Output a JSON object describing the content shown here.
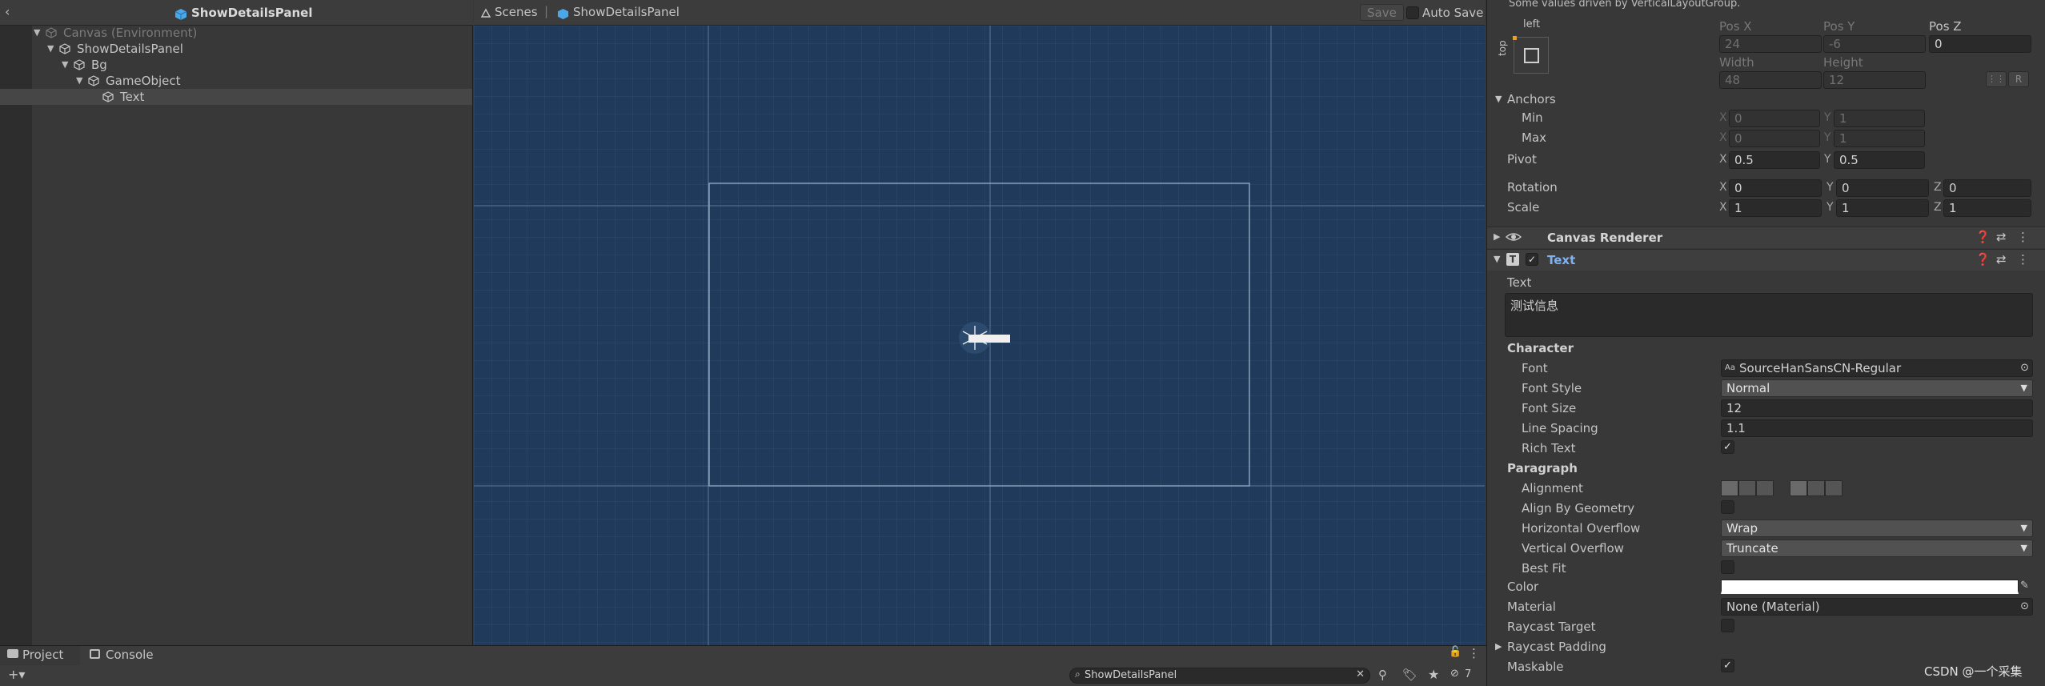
{
  "hierarchy": {
    "header_title": "ShowDetailsPanel",
    "items": [
      {
        "label": "Canvas (Environment)"
      },
      {
        "label": "ShowDetailsPanel"
      },
      {
        "label": "Bg"
      },
      {
        "label": "GameObject"
      },
      {
        "label": "Text"
      }
    ]
  },
  "scene": {
    "breadcrumb_scenes": "Scenes",
    "breadcrumb_prefab": "ShowDetailsPanel",
    "save_label": "Save",
    "autosave_label": "Auto Save"
  },
  "inspector": {
    "driven_note": "Some values driven by VerticalLayoutGroup.",
    "anchor_preset_left": "left",
    "anchor_preset_top": "top",
    "pos_labels": {
      "x": "Pos X",
      "y": "Pos Y",
      "z": "Pos Z",
      "w": "Width",
      "h": "Height"
    },
    "pos_values": {
      "x": "24",
      "y": "-6",
      "z": "0",
      "w": "48",
      "h": "12"
    },
    "raw_button": "R",
    "anchors_label": "Anchors",
    "min_label": "Min",
    "max_label": "Max",
    "anchors_min": {
      "x": "0",
      "y": "1"
    },
    "anchors_max": {
      "x": "0",
      "y": "1"
    },
    "pivot_label": "Pivot",
    "pivot": {
      "x": "0.5",
      "y": "0.5"
    },
    "rotation_label": "Rotation",
    "rotation": {
      "x": "0",
      "y": "0",
      "z": "0"
    },
    "scale_label": "Scale",
    "scale": {
      "x": "1",
      "y": "1",
      "z": "1"
    },
    "axis": {
      "x": "X",
      "y": "Y",
      "z": "Z"
    },
    "canvas_renderer_title": "Canvas Renderer",
    "text_component_title": "Text",
    "text_label": "Text",
    "text_value": "测试信息",
    "character_label": "Character",
    "font_label": "Font",
    "font_value": "SourceHanSansCN-Regular",
    "font_style_label": "Font Style",
    "font_style_value": "Normal",
    "font_size_label": "Font Size",
    "font_size_value": "12",
    "line_spacing_label": "Line Spacing",
    "line_spacing_value": "1.1",
    "rich_text_label": "Rich Text",
    "rich_text_checked": true,
    "paragraph_label": "Paragraph",
    "alignment_label": "Alignment",
    "align_by_geometry_label": "Align By Geometry",
    "horizontal_overflow_label": "Horizontal Overflow",
    "horizontal_overflow_value": "Wrap",
    "vertical_overflow_label": "Vertical Overflow",
    "vertical_overflow_value": "Truncate",
    "best_fit_label": "Best Fit",
    "color_label": "Color",
    "color_value": "#ffffff",
    "material_label": "Material",
    "material_value": "None (Material)",
    "raycast_target_label": "Raycast Target",
    "raycast_padding_label": "Raycast Padding",
    "maskable_label": "Maskable",
    "maskable_checked": true,
    "check_glyph": "✓"
  },
  "bottom": {
    "project_tab": "Project",
    "console_tab": "Console",
    "search_value": "ShowDetailsPanel",
    "hidden_count": "7"
  },
  "watermark": "CSDN @一个采集",
  "colors": {
    "accent_cube": "#4aa8e8",
    "scene_bg": "#1f3a5b",
    "component_title": "#7fb2ef"
  }
}
